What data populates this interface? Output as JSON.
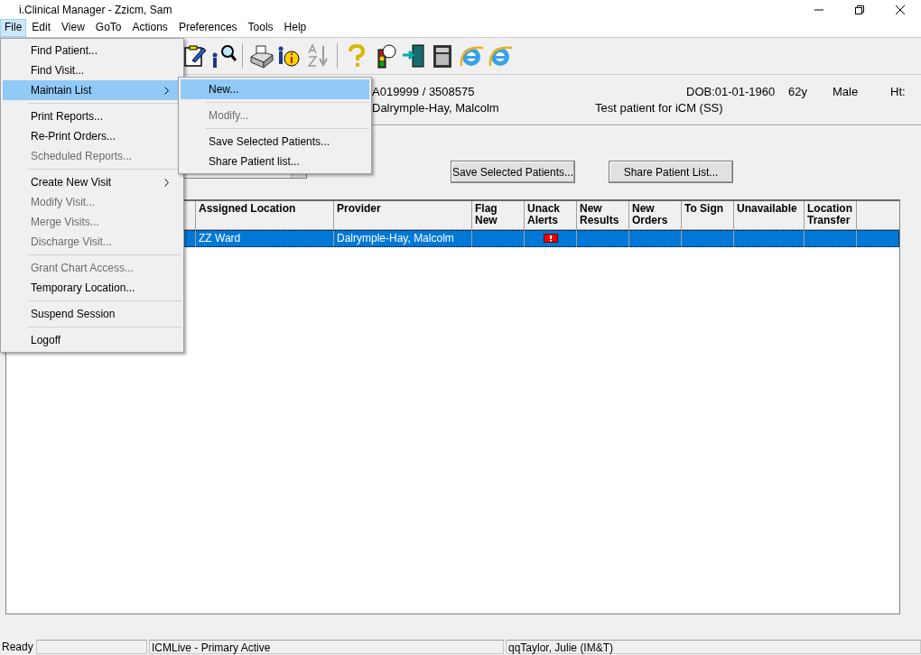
{
  "window": {
    "title": "i.Clinical Manager - Zzicm, Sam"
  },
  "menu_bar": [
    {
      "label": "File",
      "selected": true
    },
    {
      "label": "Edit",
      "selected": false
    },
    {
      "label": "View",
      "selected": false
    },
    {
      "label": "GoTo",
      "selected": false
    },
    {
      "label": "Actions",
      "selected": false
    },
    {
      "label": "Preferences",
      "selected": false
    },
    {
      "label": "Tools",
      "selected": false
    },
    {
      "label": "Help",
      "selected": false
    }
  ],
  "file_menu": [
    {
      "kind": "item",
      "label": "Find Patient...",
      "disabled": false,
      "selected": false,
      "submenu": false
    },
    {
      "kind": "item",
      "label": "Find Visit...",
      "disabled": false,
      "selected": false,
      "submenu": false
    },
    {
      "kind": "item",
      "label": "Maintain List",
      "disabled": false,
      "selected": true,
      "submenu": true
    },
    {
      "kind": "separator"
    },
    {
      "kind": "item",
      "label": "Print Reports...",
      "disabled": false,
      "selected": false,
      "submenu": false
    },
    {
      "kind": "item",
      "label": "Re-Print Orders...",
      "disabled": false,
      "selected": false,
      "submenu": false
    },
    {
      "kind": "item",
      "label": "Scheduled Reports...",
      "disabled": true,
      "selected": false,
      "submenu": false
    },
    {
      "kind": "separator"
    },
    {
      "kind": "item",
      "label": "Create New Visit",
      "disabled": false,
      "selected": false,
      "submenu": true
    },
    {
      "kind": "item",
      "label": "Modify Visit...",
      "disabled": true,
      "selected": false,
      "submenu": false
    },
    {
      "kind": "item",
      "label": "Merge Visits...",
      "disabled": true,
      "selected": false,
      "submenu": false
    },
    {
      "kind": "item",
      "label": "Discharge Visit...",
      "disabled": true,
      "selected": false,
      "submenu": false
    },
    {
      "kind": "separator"
    },
    {
      "kind": "item",
      "label": "Grant Chart Access...",
      "disabled": true,
      "selected": false,
      "submenu": false
    },
    {
      "kind": "item",
      "label": "Temporary Location...",
      "disabled": false,
      "selected": false,
      "submenu": false
    },
    {
      "kind": "separator"
    },
    {
      "kind": "item",
      "label": "Suspend Session",
      "disabled": false,
      "selected": false,
      "submenu": false
    },
    {
      "kind": "separator"
    },
    {
      "kind": "item",
      "label": "Logoff",
      "disabled": false,
      "selected": false,
      "submenu": false
    }
  ],
  "submenu": [
    {
      "kind": "item",
      "label": "New...",
      "disabled": false,
      "selected": true
    },
    {
      "kind": "separator"
    },
    {
      "kind": "item",
      "label": "Modify...",
      "disabled": true,
      "selected": false
    },
    {
      "kind": "separator"
    },
    {
      "kind": "item",
      "label": "Save Selected Patients...",
      "disabled": false,
      "selected": false
    },
    {
      "kind": "item",
      "label": "Share Patient list...",
      "disabled": false,
      "selected": false
    }
  ],
  "patient_banner": {
    "ids": "A019999 / 3508575",
    "name": "Dalrymple-Hay, Malcolm",
    "dob": "DOB:01-01-1960",
    "age": "62y",
    "sex": "Male",
    "height": "Ht:",
    "note": "Test patient for iCM (SS)"
  },
  "buttons": [
    "Save Selected Patients...",
    "Share Patient List..."
  ],
  "table": {
    "columns": [
      "Assigned Location",
      "Provider",
      "Flag New",
      "Unack Alerts",
      "New Results",
      "New Orders",
      "To Sign",
      "Unavailable",
      "Location Transfer"
    ],
    "rows": [
      {
        "selected": true,
        "unack_alert": true,
        "cells": [
          "ZZ Ward",
          "Dalrymple-Hay, Malcolm",
          "",
          "",
          "",
          "",
          "",
          "",
          ""
        ]
      }
    ]
  },
  "status_bar": [
    "Ready",
    "ICMLive - Primary Active",
    "qqTaylor, Julie (IM&T)"
  ]
}
